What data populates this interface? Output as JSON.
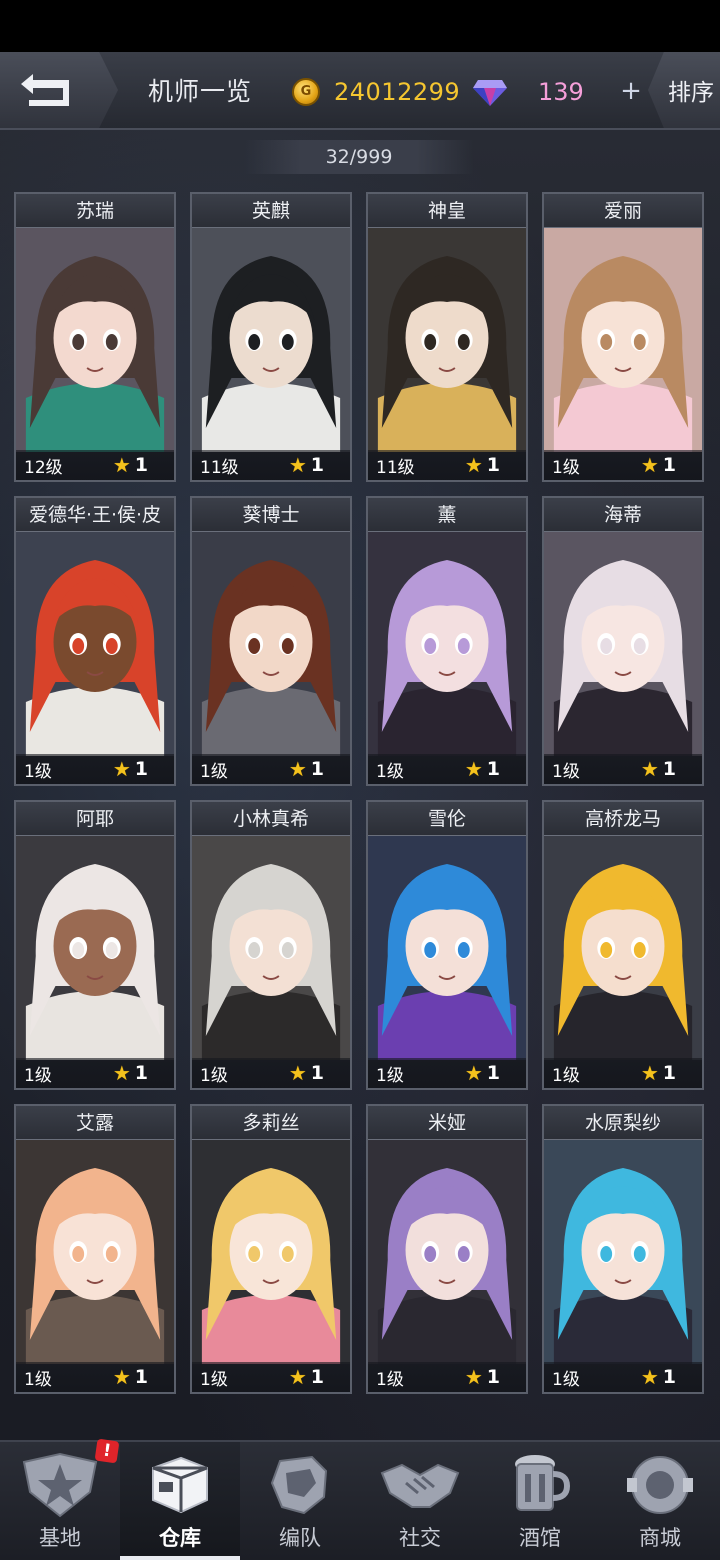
{
  "header": {
    "title": "机师一览",
    "gold": "24012299",
    "gems": "139",
    "plus_label": "+",
    "sort_label": "排序"
  },
  "roster_count": "32/999",
  "colors": {
    "gold_text": "#f5c630",
    "gem_text": "#f59fd9",
    "star": "#f4c21d",
    "badge": "#e0242a"
  },
  "characters": [
    {
      "name": "苏瑞",
      "level": "12级",
      "rank": "1",
      "hair": "#4a3a36",
      "skin": "#f3d9cf",
      "outfit": "#2f8f7c",
      "bg": "#5b5560"
    },
    {
      "name": "英麒",
      "level": "11级",
      "rank": "1",
      "hair": "#1d1f22",
      "skin": "#ecdccf",
      "outfit": "#e8e8e6",
      "bg": "#4d5059"
    },
    {
      "name": "神皇",
      "level": "11级",
      "rank": "1",
      "hair": "#2e2823",
      "skin": "#eedbcb",
      "outfit": "#d9b15a",
      "bg": "#3a3735"
    },
    {
      "name": "爱丽",
      "level": "1级",
      "rank": "1",
      "hair": "#b98a62",
      "skin": "#f7e2d6",
      "outfit": "#f4c9d3",
      "bg": "#c9a9a3"
    },
    {
      "name": "爱德华·王·侯·皮",
      "level": "1级",
      "rank": "1",
      "hair": "#d8432a",
      "skin": "#7a4a2e",
      "outfit": "#e9e7e2",
      "bg": "#3d4250"
    },
    {
      "name": "葵博士",
      "level": "1级",
      "rank": "1",
      "hair": "#6a3222",
      "skin": "#f2d8c8",
      "outfit": "#6a6a72",
      "bg": "#3a3d48"
    },
    {
      "name": "薰",
      "level": "1级",
      "rank": "1",
      "hair": "#b79ad8",
      "skin": "#f3dfe0",
      "outfit": "#2a2430",
      "bg": "#35323f"
    },
    {
      "name": "海蒂",
      "level": "1级",
      "rank": "1",
      "hair": "#e7dde4",
      "skin": "#f7e6e2",
      "outfit": "#2b2630",
      "bg": "#5a5561"
    },
    {
      "name": "阿耶",
      "level": "1级",
      "rank": "1",
      "hair": "#ece6e4",
      "skin": "#9a6a52",
      "outfit": "#e8e4e0",
      "bg": "#3b3a3f"
    },
    {
      "name": "小林真希",
      "level": "1级",
      "rank": "1",
      "hair": "#d6d4d0",
      "skin": "#f3e0d4",
      "outfit": "#2c2a2a",
      "bg": "#4a4848"
    },
    {
      "name": "雪伦",
      "level": "1级",
      "rank": "1",
      "hair": "#2e8ad9",
      "skin": "#f4e0d8",
      "outfit": "#6b3fb0",
      "bg": "#2f3850"
    },
    {
      "name": "高桥龙马",
      "level": "1级",
      "rank": "1",
      "hair": "#f0b92e",
      "skin": "#f5dece",
      "outfit": "#26252c",
      "bg": "#3a3d46"
    },
    {
      "name": "艾露",
      "level": "1级",
      "rank": "1",
      "hair": "#f2b48d",
      "skin": "#f8e2d6",
      "outfit": "#6a5a50",
      "bg": "#3c3634"
    },
    {
      "name": "多莉丝",
      "level": "1级",
      "rank": "1",
      "hair": "#f0c86a",
      "skin": "#f8e5d8",
      "outfit": "#e88a9a",
      "bg": "#2e2f33"
    },
    {
      "name": "米娅",
      "level": "1级",
      "rank": "1",
      "hair": "#9a7fc6",
      "skin": "#f2dfdc",
      "outfit": "#2a2830",
      "bg": "#323038"
    },
    {
      "name": "水原梨纱",
      "level": "1级",
      "rank": "1",
      "hair": "#3fb8df",
      "skin": "#f6e2d8",
      "outfit": "#2a2a38",
      "bg": "#3a4858"
    }
  ],
  "nav": [
    {
      "label": "基地",
      "icon": "base-star-icon",
      "badge": "!"
    },
    {
      "label": "仓库",
      "icon": "warehouse-box-icon"
    },
    {
      "label": "编队",
      "icon": "squad-mech-icon"
    },
    {
      "label": "社交",
      "icon": "handshake-icon"
    },
    {
      "label": "酒馆",
      "icon": "tavern-mug-icon"
    },
    {
      "label": "商城",
      "icon": "shop-globe-icon"
    }
  ]
}
